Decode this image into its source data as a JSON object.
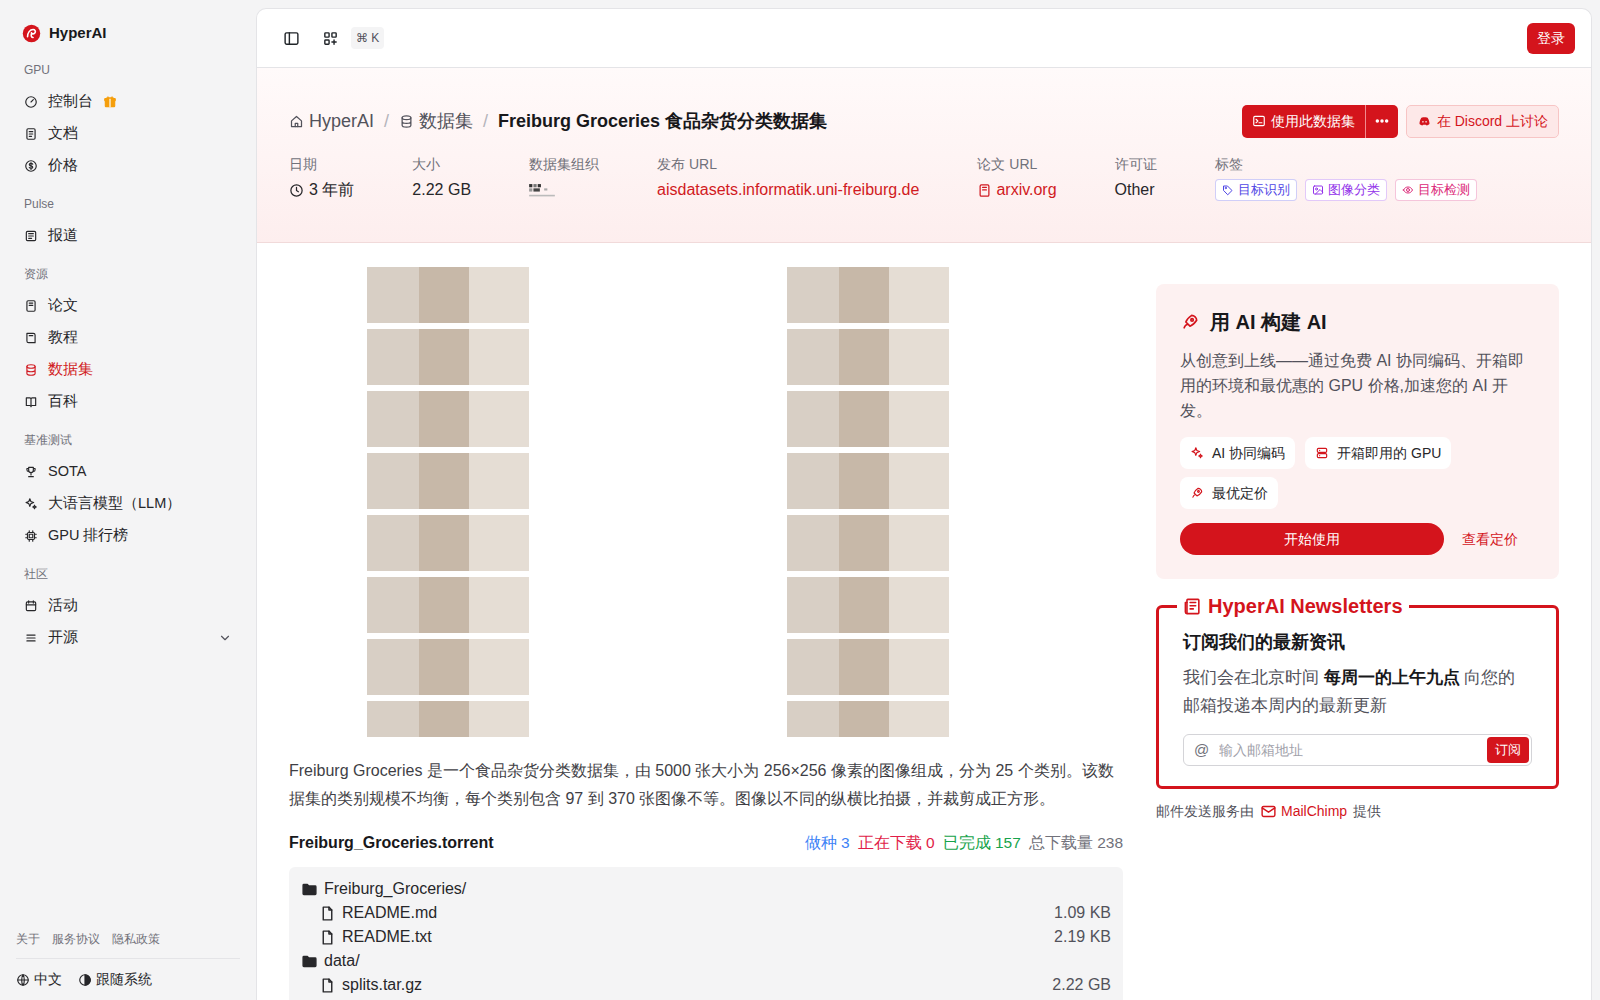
{
  "brand": {
    "name": "HyperAI"
  },
  "sidebar": {
    "sections": [
      {
        "title": "GPU",
        "items": [
          {
            "label": "控制台",
            "selected": false,
            "has_gift": true
          },
          {
            "label": "文档",
            "selected": false
          },
          {
            "label": "价格",
            "selected": false
          }
        ]
      },
      {
        "title": "Pulse",
        "items": [
          {
            "label": "报道",
            "selected": false
          }
        ]
      },
      {
        "title": "资源",
        "items": [
          {
            "label": "论文",
            "selected": false
          },
          {
            "label": "教程",
            "selected": false
          },
          {
            "label": "数据集",
            "selected": true
          },
          {
            "label": "百科",
            "selected": false
          }
        ]
      },
      {
        "title": "基准测试",
        "items": [
          {
            "label": "SOTA",
            "selected": false
          },
          {
            "label": "大语言模型（LLM）",
            "selected": false
          },
          {
            "label": "GPU 排行榜",
            "selected": false
          }
        ]
      },
      {
        "title": "社区",
        "items": [
          {
            "label": "活动",
            "selected": false
          },
          {
            "label": "开源",
            "selected": false,
            "expanded": false
          }
        ]
      }
    ],
    "footer_links": [
      "关于",
      "服务协议",
      "隐私政策"
    ],
    "language": "中文",
    "theme": "跟随系统"
  },
  "topbar": {
    "shortcut": "⌘ K",
    "login": "登录"
  },
  "header": {
    "breadcrumb": [
      {
        "label": "HyperAI",
        "current": false
      },
      {
        "label": "数据集",
        "current": false
      },
      {
        "label": "Freiburg Groceries 食品杂货分类数据集",
        "current": true
      }
    ],
    "separator": "/",
    "use_button": "使用此数据集",
    "discord_button": "在 Discord 上讨论",
    "meta": [
      {
        "kind": "time",
        "label": "日期",
        "value": "3 年前"
      },
      {
        "kind": "text",
        "label": "大小",
        "value": "2.22 GB"
      },
      {
        "kind": "logo",
        "label": "数据集组织"
      },
      {
        "kind": "link",
        "label": "发布 URL",
        "value": "aisdatasets.informatik.uni-freiburg.de"
      },
      {
        "kind": "doc-link",
        "label": "论文 URL",
        "value": "arxiv.org"
      },
      {
        "kind": "text",
        "label": "许可证",
        "value": "Other"
      },
      {
        "kind": "tags",
        "label": "标签",
        "tags": [
          {
            "label": "目标识别",
            "color": "#4f46e5"
          },
          {
            "label": "图像分类",
            "color": "#9333ea"
          },
          {
            "label": "目标检测",
            "color": "#db2777"
          }
        ]
      }
    ]
  },
  "description": "Freiburg Groceries 是一个食品杂货分类数据集，由 5000 张大小为 256×256 像素的图像组成，分为 25 个类别。该数据集的类别规模不均衡，每个类别包含 97 到 370 张图像不等。图像以不同的纵横比拍摄，并裁剪成正方形。",
  "torrent": {
    "name": "Freiburg_Groceries.torrent",
    "stats": [
      {
        "text": "做种 3",
        "color": "#3b82f6"
      },
      {
        "text": "正在下载 0",
        "color": "#e11d48"
      },
      {
        "text": "已完成 157",
        "color": "#16a34a"
      },
      {
        "text": "总下载量 238",
        "color": "#71717a"
      }
    ],
    "files": [
      {
        "kind": "folder",
        "name": "Freiburg_Groceries/"
      },
      {
        "kind": "file",
        "name": "README.md",
        "size": "1.09 KB"
      },
      {
        "kind": "file",
        "name": "README.txt",
        "size": "2.19 KB"
      },
      {
        "kind": "folder",
        "name": "data/"
      },
      {
        "kind": "file",
        "name": "splits.tar.gz",
        "size": "2.22 GB"
      }
    ]
  },
  "promo": {
    "title": "用 AI 构建 AI",
    "text": "从创意到上线——通过免费 AI 协同编码、开箱即用的环境和最优惠的 GPU 价格,加速您的 AI 开发。",
    "features": [
      "AI 协同编码",
      "开箱即用的 GPU",
      "最优定价"
    ],
    "start": "开始使用",
    "pricing": "查看定价"
  },
  "newsletter": {
    "title": "HyperAI Newsletters",
    "heading": "订阅我们的最新资讯",
    "text_before": "我们会在北京时间 ",
    "text_bold": "每周一的上午九点",
    "text_after": " 向您的邮箱投递本周内的最新更新",
    "at": "@",
    "placeholder": "输入邮箱地址",
    "button": "订阅",
    "footer_before": "邮件发送服务由",
    "footer_link": "MailChimp",
    "footer_after": "提供"
  }
}
